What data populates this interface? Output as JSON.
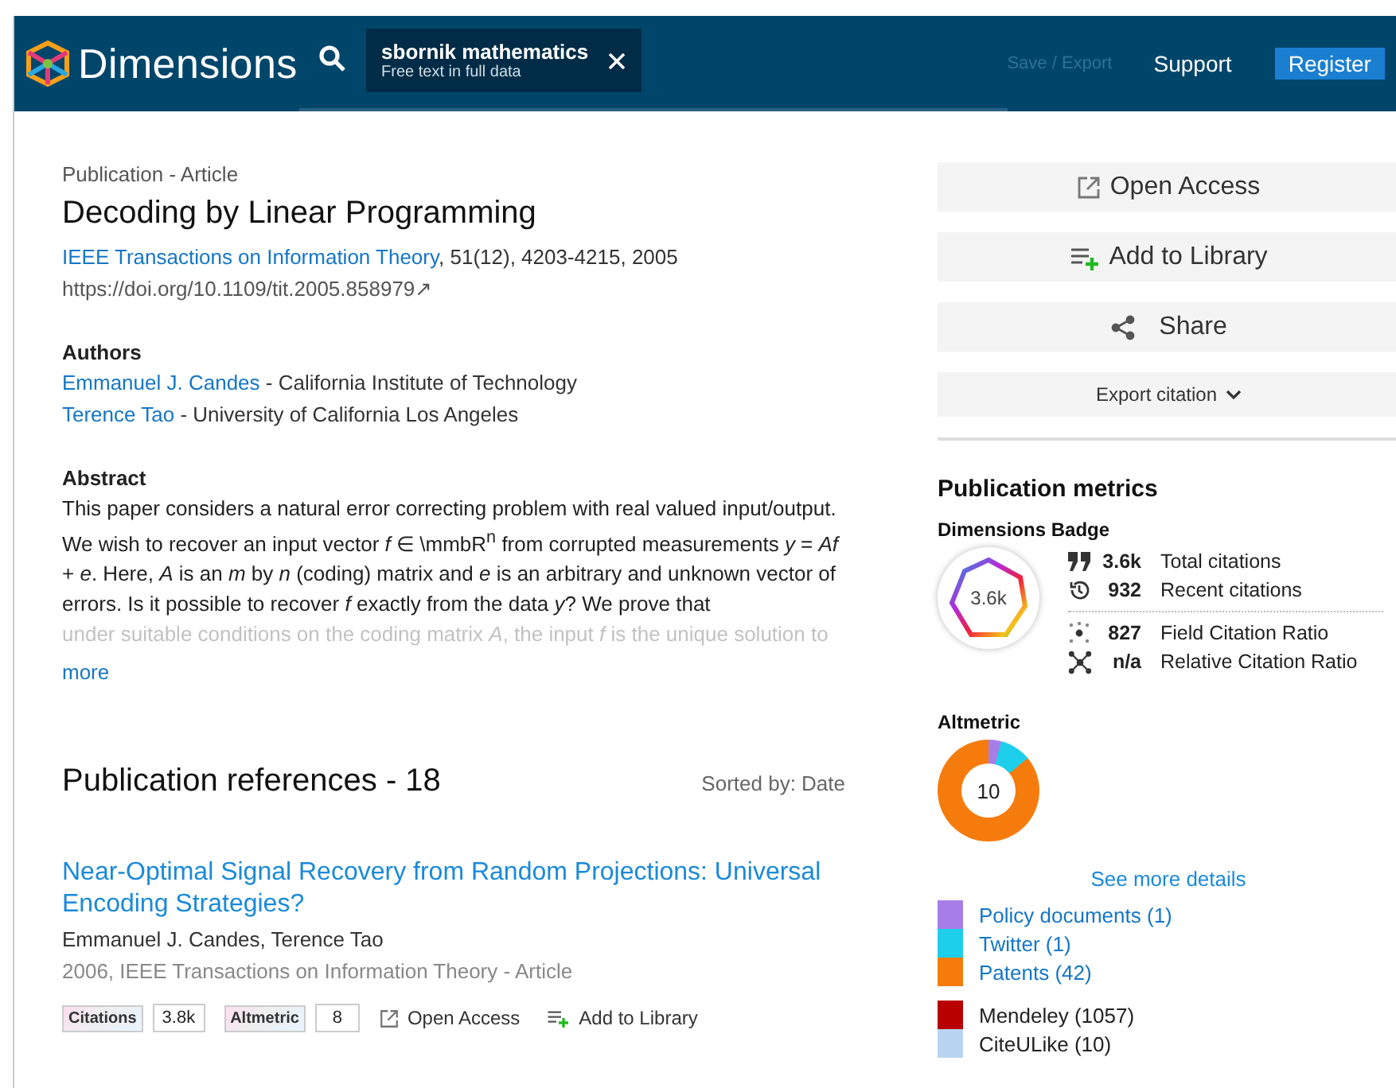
{
  "header": {
    "logo_text": "Dimensions",
    "search": {
      "query": "sbornik mathematics",
      "hint": "Free text in full data"
    },
    "save_export": "Save / Export",
    "support": "Support",
    "register": "Register"
  },
  "publication": {
    "type": "Publication - Article",
    "title": "Decoding by Linear Programming",
    "journal": "IEEE Transactions on Information Theory",
    "journal_details": ", 51(12), 4203-4215, 2005",
    "doi": "https://doi.org/10.1109/tit.2005.858979",
    "doi_arrow": "↗"
  },
  "authors": {
    "heading": "Authors",
    "items": [
      {
        "name": "Emmanuel J. Candes",
        "affiliation": " - California Institute of Technology"
      },
      {
        "name": "Terence Tao",
        "affiliation": " - University of California Los Angeles"
      }
    ]
  },
  "abstract": {
    "heading": "Abstract",
    "text": "This paper considers a natural error correcting problem with real valued input/output. We wish to recover an input vector *f* ∈ \\mmbR$^{n}$ from corrupted measurements *y* = *Af* + *e*. Here, *A* is an *m* by *n* (coding) matrix and *e* is an arbitrary and unknown vector of errors. Is it possible to recover *f* exactly from the data *y*? We prove that",
    "faded_text": "under suitable conditions on the coding matrix *A*, the input *f* is the unique solution to",
    "more": "more"
  },
  "references": {
    "heading": "Publication references - 18",
    "sort": "Sorted by: Date",
    "items": [
      {
        "title": "Near-Optimal Signal Recovery from Random Projections: Universal Encoding Strategies?",
        "authors": "Emmanuel J. Candes, Terence Tao",
        "meta": "2006, IEEE Transactions on Information Theory - Article",
        "citations_label": "Citations",
        "citations": "3.8k",
        "altmetric_label": "Altmetric",
        "altmetric": "8",
        "open_access": "Open Access",
        "add_to_library": "Add to Library"
      }
    ]
  },
  "actions": [
    {
      "kind": "open",
      "label": "Open Access"
    },
    {
      "kind": "library",
      "label": "Add to Library"
    },
    {
      "kind": "share",
      "label": "Share"
    },
    {
      "kind": "export",
      "label": "Export citation"
    }
  ],
  "metrics": {
    "heading": "Publication metrics",
    "badge_heading": "Dimensions Badge",
    "badge_value": "3.6k",
    "stats": [
      {
        "kind": "quote",
        "value": "3.6k",
        "label": "Total citations"
      },
      {
        "kind": "history",
        "value": "932",
        "label": "Recent citations"
      },
      {
        "kind": "fcr",
        "value": "827",
        "label": "Field Citation Ratio"
      },
      {
        "kind": "rcr",
        "value": "n/a",
        "label": "Relative Citation Ratio"
      }
    ],
    "altmetric_heading": "Altmetric",
    "altmetric_score": "10",
    "see_more": "See more details",
    "legend": [
      {
        "kind": "link",
        "label": "Policy documents (1)",
        "color": "#a77ee8"
      },
      {
        "kind": "link",
        "label": "Twitter (1)",
        "color": "#1dcfeb"
      },
      {
        "kind": "link",
        "label": "Patents (42)",
        "color": "#f57c0c"
      },
      {
        "kind": "reader",
        "label": "Mendeley (1057)",
        "color": "#b80000"
      },
      {
        "kind": "reader",
        "label": "CiteULike (10)",
        "color": "#b8d4f0"
      }
    ]
  }
}
